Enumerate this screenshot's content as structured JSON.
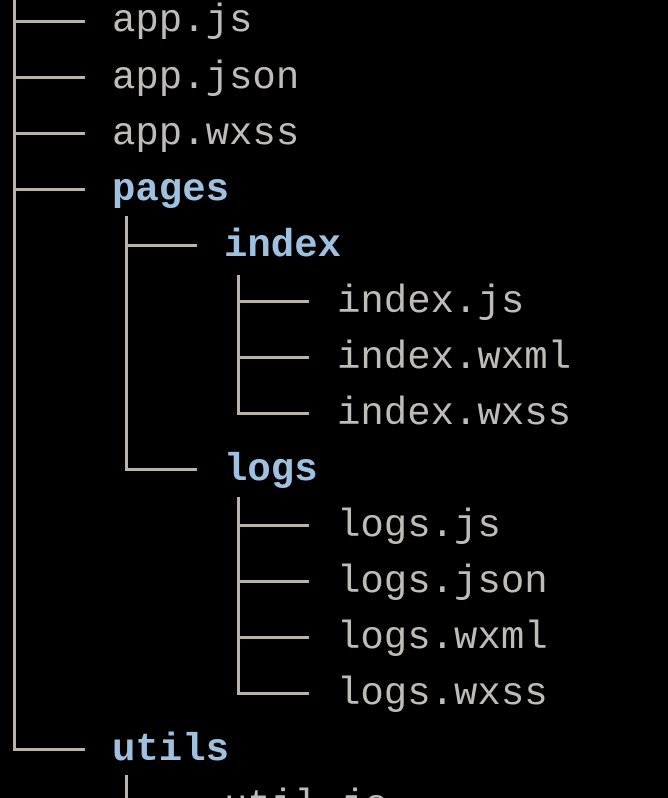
{
  "tree": {
    "items": [
      {
        "label": "app.js",
        "kind": "file",
        "depth": 0
      },
      {
        "label": "app.json",
        "kind": "file",
        "depth": 0
      },
      {
        "label": "app.wxss",
        "kind": "file",
        "depth": 0
      },
      {
        "label": "pages",
        "kind": "folder",
        "depth": 0
      },
      {
        "label": "index",
        "kind": "folder",
        "depth": 1
      },
      {
        "label": "index.js",
        "kind": "file",
        "depth": 2
      },
      {
        "label": "index.wxml",
        "kind": "file",
        "depth": 2
      },
      {
        "label": "index.wxss",
        "kind": "file",
        "depth": 2
      },
      {
        "label": "logs",
        "kind": "folder",
        "depth": 1
      },
      {
        "label": "logs.js",
        "kind": "file",
        "depth": 2
      },
      {
        "label": "logs.json",
        "kind": "file",
        "depth": 2
      },
      {
        "label": "logs.wxml",
        "kind": "file",
        "depth": 2
      },
      {
        "label": "logs.wxss",
        "kind": "file",
        "depth": 2
      },
      {
        "label": "utils",
        "kind": "folder",
        "depth": 0
      },
      {
        "label": "util.js",
        "kind": "file",
        "depth": 1
      }
    ]
  },
  "colors": {
    "background": "#000000",
    "file_text": "#bebcb6",
    "folder_text": "#9fc0df",
    "connector": "#b9b4a7"
  }
}
